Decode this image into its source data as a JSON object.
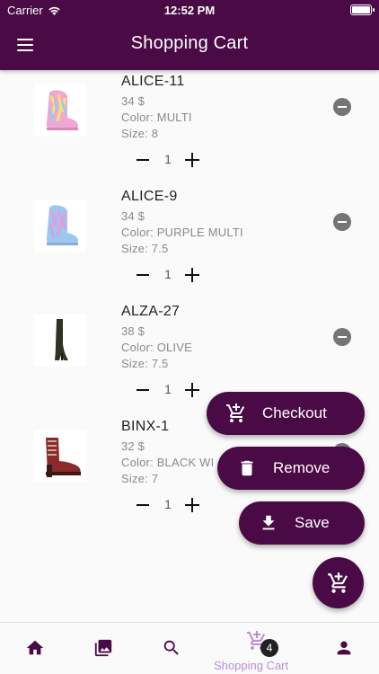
{
  "status_bar": {
    "carrier": "Carrier",
    "time": "12:52 PM"
  },
  "app_bar": {
    "title": "Shopping Cart"
  },
  "colors": {
    "primary": "#4a0a46",
    "nav_active": "#b58fd8",
    "remove_icon": "#757575"
  },
  "cart_items": [
    {
      "name": "ALICE-11",
      "price": "34 $",
      "color": "Color: MULTI",
      "size": "Size: 8",
      "quantity": "1",
      "image": "pink-furry-boot"
    },
    {
      "name": "ALICE-9",
      "price": "34 $",
      "color": "Color: PURPLE MULTI",
      "size": "Size: 7.5",
      "quantity": "1",
      "image": "blue-furry-boot"
    },
    {
      "name": "ALZA-27",
      "price": "38 $",
      "color": "Color: OLIVE",
      "size": "Size: 7.5",
      "quantity": "1",
      "image": "olive-thigh-high-boot"
    },
    {
      "name": "BINX-1",
      "price": "32 $",
      "color": "Color: BLACK WI",
      "size": "Size: 7",
      "quantity": "1",
      "image": "red-lace-up-boot"
    }
  ],
  "fab_menu": {
    "checkout_label": "Checkout",
    "remove_label": "Remove",
    "save_label": "Save"
  },
  "bottom_nav": {
    "items": [
      "home-icon",
      "gallery-icon",
      "search-icon",
      "cart-icon",
      "profile-icon"
    ],
    "cart_label": "Shopping Cart",
    "cart_badge": "4"
  }
}
